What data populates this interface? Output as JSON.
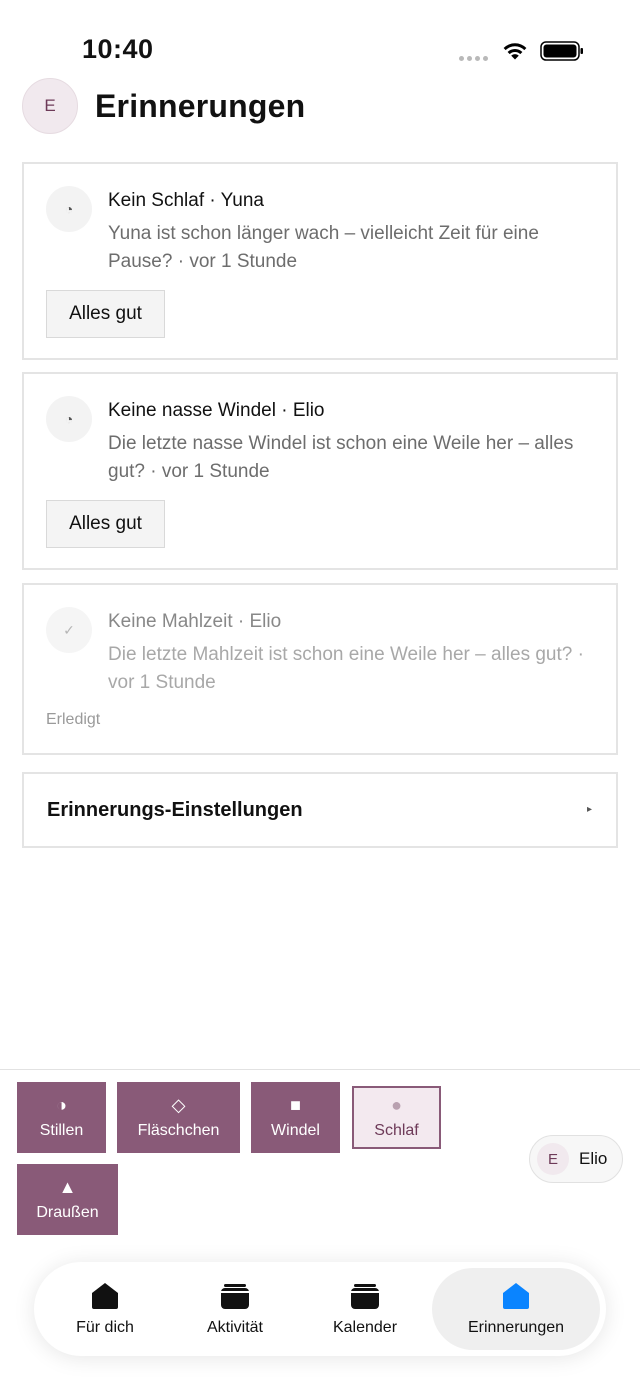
{
  "status_bar": {
    "time": "10:40"
  },
  "header": {
    "avatar_initial": "E",
    "title": "Erinnerungen"
  },
  "reminders": [
    {
      "icon": "◔",
      "title": "Kein Schlaf · Yuna",
      "body": "Yuna ist schon länger wach – vielleicht Zeit für eine Pause? · vor 1 Stunde",
      "action_label": "Alles gut"
    },
    {
      "icon": "◔",
      "title": "Keine nasse Windel · Elio",
      "body": "Die letzte nasse Windel ist schon eine Weile her – alles gut? · vor 1 Stunde",
      "action_label": "Alles gut"
    },
    {
      "icon": "✓",
      "title": "Keine Mahlzeit · Elio",
      "body": "Die letzte Mahlzeit ist schon eine Weile her – alles gut? · vor 1 Stunde",
      "status_label": "Erledigt"
    }
  ],
  "settings": {
    "label": "Erinnerungs-Einstellungen",
    "chevron": "▸"
  },
  "quick_actions": [
    {
      "icon": "◑",
      "label": "Stillen"
    },
    {
      "icon": "◇",
      "label": "Fläschchen"
    },
    {
      "icon": "■",
      "label": "Windel"
    },
    {
      "icon": "●",
      "label": "Schlaf"
    },
    {
      "icon": "▲",
      "label": "Draußen"
    }
  ],
  "baby_switcher": {
    "initial": "E",
    "name": "Elio"
  },
  "tabs": [
    {
      "label": "Für dich",
      "icon": "home-icon"
    },
    {
      "label": "Aktivität",
      "icon": "activity-icon"
    },
    {
      "label": "Kalender",
      "icon": "calendar-icon"
    },
    {
      "label": "Erinnerungen",
      "icon": "reminders-icon",
      "active": true
    }
  ],
  "colors": {
    "accent": "#895a78",
    "active_tab_icon": "#0a84ff",
    "muted_text": "#6d6d6d"
  }
}
